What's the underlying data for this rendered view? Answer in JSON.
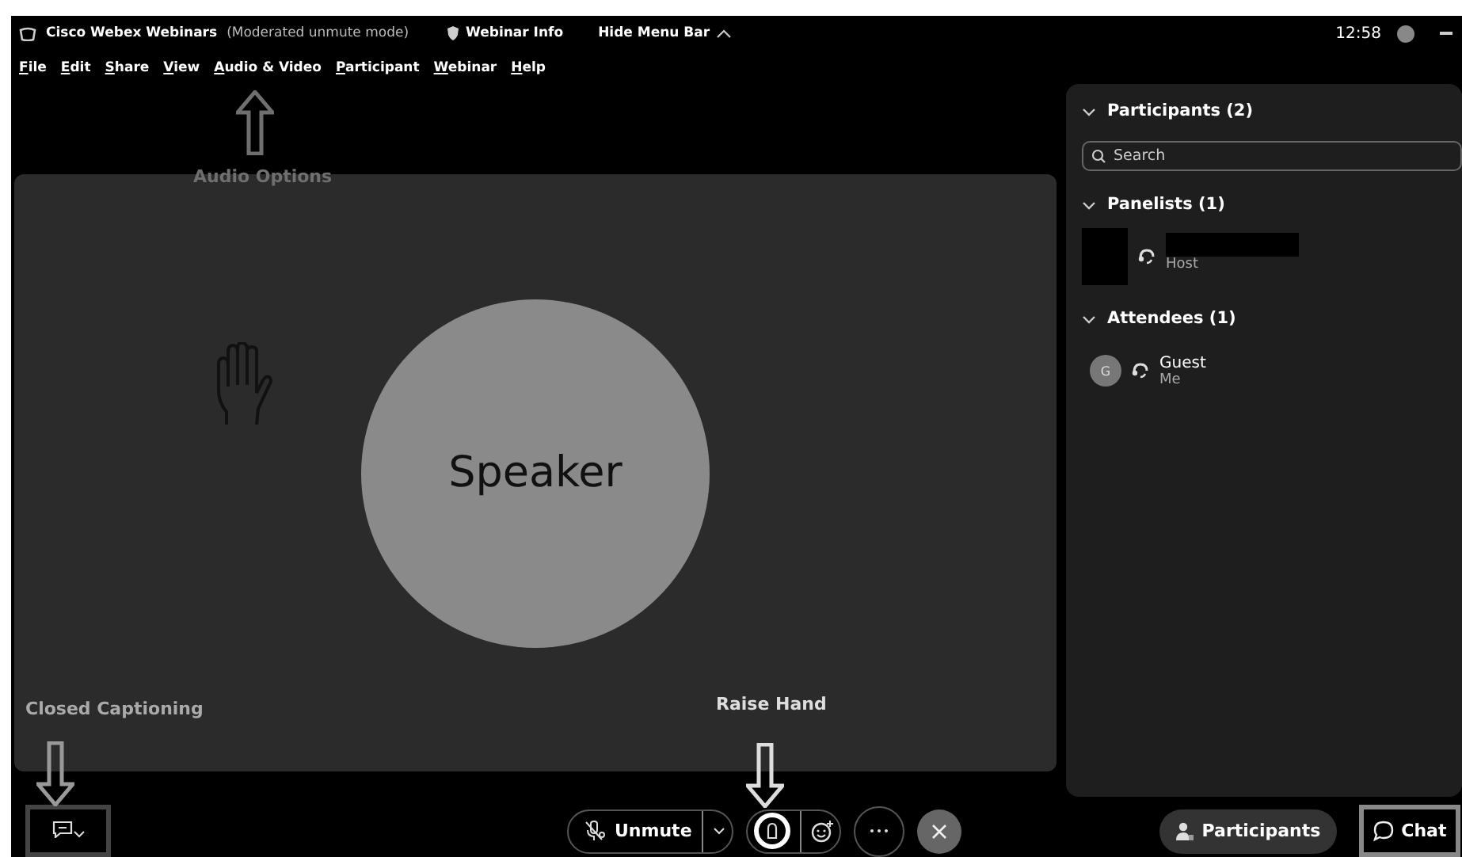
{
  "title_bar": {
    "app": "Cisco Webex Webinars",
    "mode": "(Moderated unmute mode)",
    "info": "Webinar Info",
    "hide_menu": "Hide Menu Bar",
    "time": "12:58"
  },
  "menu": [
    {
      "label": "File"
    },
    {
      "label": "Edit"
    },
    {
      "label": "Share"
    },
    {
      "label": "View"
    },
    {
      "label": "Audio & Video"
    },
    {
      "label": "Participant"
    },
    {
      "label": "Webinar"
    },
    {
      "label": "Help"
    }
  ],
  "stage": {
    "speaker": "Speaker"
  },
  "panel": {
    "title": "Participants (2)",
    "expanded": true,
    "search_placeholder": "Search",
    "sections": [
      {
        "title": "Panelists (1)",
        "expanded": true,
        "people": [
          {
            "kind": "redacted",
            "role": "Host"
          }
        ]
      },
      {
        "title": "Attendees (1)",
        "expanded": true,
        "people": [
          {
            "kind": "initial",
            "initial": "G",
            "name": "Guest",
            "role": "Me"
          }
        ]
      }
    ]
  },
  "toolbar": {
    "captions": {
      "highlighted": true
    },
    "unmute": "Unmute",
    "raise_hand": {
      "highlighted": true
    },
    "participants": "Participants",
    "chat": {
      "label": "Chat",
      "highlighted": true
    }
  },
  "annotations": [
    {
      "label": "Audio Options",
      "kind": "up"
    },
    {
      "label": "Closed Captioning",
      "kind": "down"
    },
    {
      "label": "Raise Hand",
      "kind": "down"
    }
  ]
}
